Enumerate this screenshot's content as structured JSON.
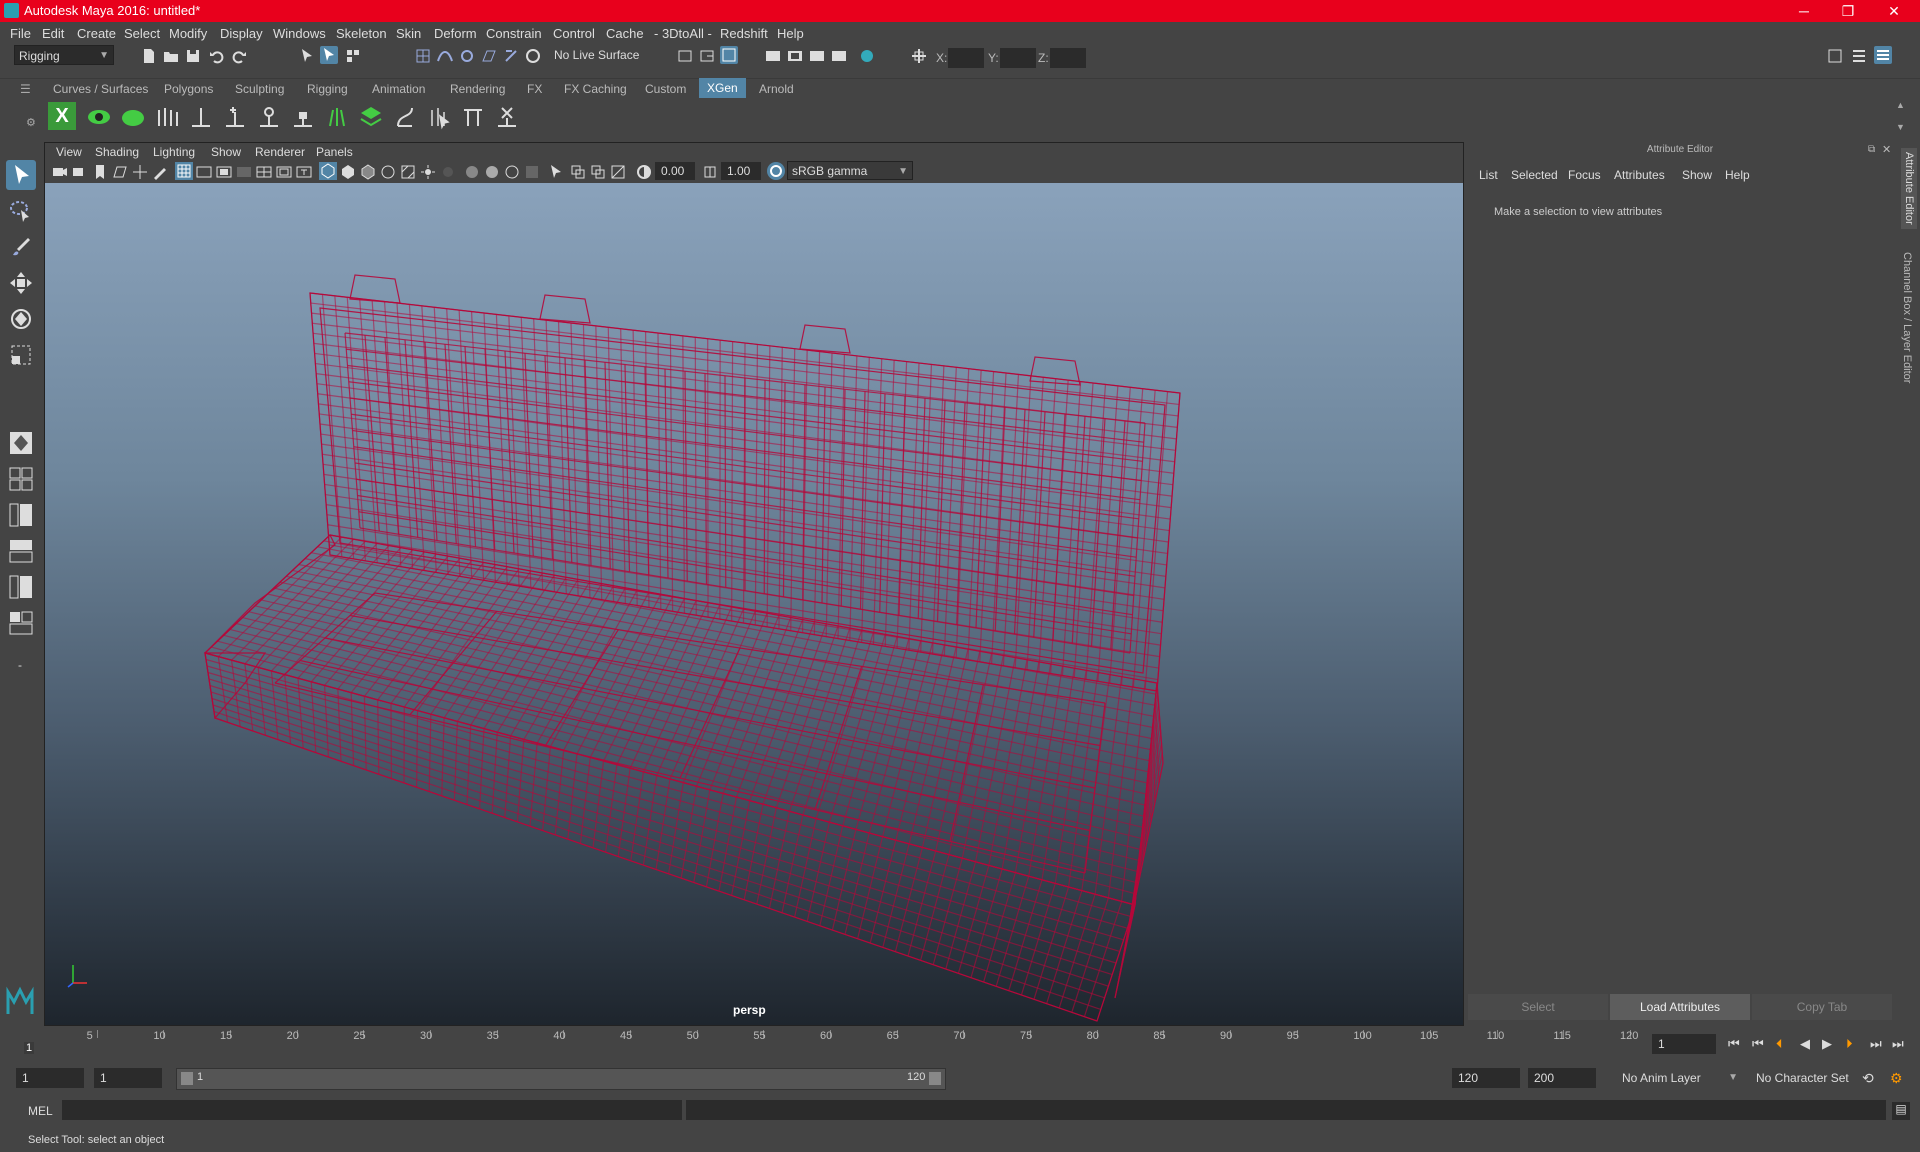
{
  "window": {
    "title": "Autodesk Maya 2016: untitled*",
    "minimize": "─",
    "maximize": "❐",
    "close": "✕"
  },
  "menubar": [
    "File",
    "Edit",
    "Create",
    "Select",
    "Modify",
    "Display",
    "Windows",
    "Skeleton",
    "Skin",
    "Deform",
    "Constrain",
    "Control",
    "Cache",
    "- 3DtoAll -",
    "Redshift",
    "Help"
  ],
  "status_line": {
    "menu_set": "Rigging",
    "live_surface": "No Live Surface",
    "x_label": "X:",
    "y_label": "Y:",
    "z_label": "Z:"
  },
  "shelf_tabs": [
    "Curves / Surfaces",
    "Polygons",
    "Sculpting",
    "Rigging",
    "Animation",
    "Rendering",
    "FX",
    "FX Caching",
    "Custom",
    "XGen",
    "Arnold"
  ],
  "active_shelf_tab": "XGen",
  "viewport": {
    "menus": [
      "View",
      "Shading",
      "Lighting",
      "Show",
      "Renderer",
      "Panels"
    ],
    "exposure": "0.00",
    "gamma": "1.00",
    "color_space": "sRGB gamma",
    "camera_label": "persp",
    "wireframe_color": "#b5083a"
  },
  "attribute_editor": {
    "title": "Attribute Editor",
    "menus": [
      "List",
      "Selected",
      "Focus",
      "Attributes",
      "Show",
      "Help"
    ],
    "message": "Make a selection to view attributes",
    "buttons": {
      "select": "Select",
      "load": "Load Attributes",
      "copy": "Copy Tab"
    },
    "side_tabs": [
      "Attribute Editor",
      "Channel Box / Layer Editor"
    ]
  },
  "time_slider": {
    "ticks": [
      "5",
      "10",
      "15",
      "20",
      "25",
      "30",
      "35",
      "40",
      "45",
      "50",
      "55",
      "60",
      "65",
      "70",
      "75",
      "80",
      "85",
      "90",
      "95",
      "100",
      "105",
      "110",
      "115",
      "120"
    ],
    "current_frame_marker": "1",
    "current_frame": "1"
  },
  "range_slider": {
    "start": "1",
    "playback_start": "1",
    "bar_start": "1",
    "bar_end": "120",
    "playback_end": "120",
    "end": "200",
    "anim_layer": "No Anim Layer",
    "character_set": "No Character Set"
  },
  "command_line": {
    "language": "MEL"
  },
  "help_line": {
    "text": "Select Tool: select an object"
  }
}
